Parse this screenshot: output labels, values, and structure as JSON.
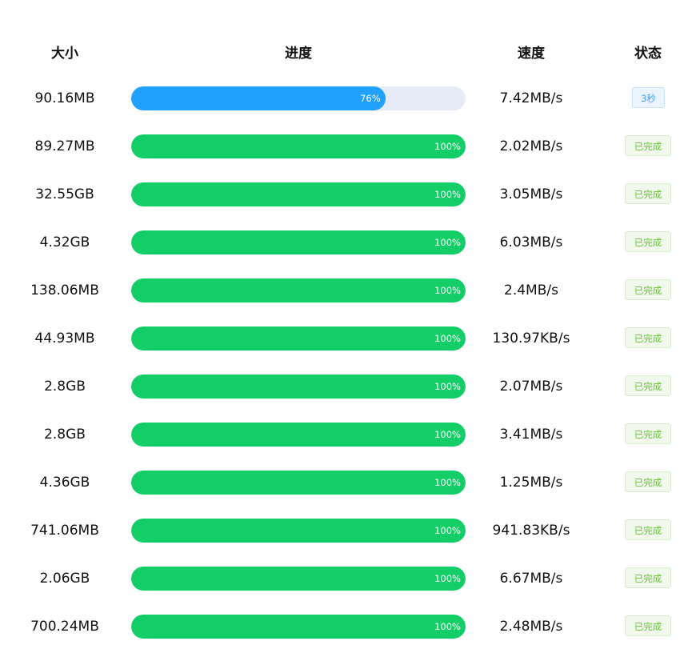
{
  "header": {
    "size": "大小",
    "progress": "进度",
    "speed": "速度",
    "status": "状态"
  },
  "colors": {
    "active": "#20a0ff",
    "done": "#13ce66",
    "track": "#e6ebf5"
  },
  "rows": [
    {
      "size": "90.16MB",
      "progress_pct": 76,
      "progress_label": "76%",
      "speed": "7.42MB/s",
      "status": "3秒",
      "state": "active"
    },
    {
      "size": "89.27MB",
      "progress_pct": 100,
      "progress_label": "100%",
      "speed": "2.02MB/s",
      "status": "已完成",
      "state": "done"
    },
    {
      "size": "32.55GB",
      "progress_pct": 100,
      "progress_label": "100%",
      "speed": "3.05MB/s",
      "status": "已完成",
      "state": "done"
    },
    {
      "size": "4.32GB",
      "progress_pct": 100,
      "progress_label": "100%",
      "speed": "6.03MB/s",
      "status": "已完成",
      "state": "done"
    },
    {
      "size": "138.06MB",
      "progress_pct": 100,
      "progress_label": "100%",
      "speed": "2.4MB/s",
      "status": "已完成",
      "state": "done"
    },
    {
      "size": "44.93MB",
      "progress_pct": 100,
      "progress_label": "100%",
      "speed": "130.97KB/s",
      "status": "已完成",
      "state": "done"
    },
    {
      "size": "2.8GB",
      "progress_pct": 100,
      "progress_label": "100%",
      "speed": "2.07MB/s",
      "status": "已完成",
      "state": "done"
    },
    {
      "size": "2.8GB",
      "progress_pct": 100,
      "progress_label": "100%",
      "speed": "3.41MB/s",
      "status": "已完成",
      "state": "done"
    },
    {
      "size": "4.36GB",
      "progress_pct": 100,
      "progress_label": "100%",
      "speed": "1.25MB/s",
      "status": "已完成",
      "state": "done"
    },
    {
      "size": "741.06MB",
      "progress_pct": 100,
      "progress_label": "100%",
      "speed": "941.83KB/s",
      "status": "已完成",
      "state": "done"
    },
    {
      "size": "2.06GB",
      "progress_pct": 100,
      "progress_label": "100%",
      "speed": "6.67MB/s",
      "status": "已完成",
      "state": "done"
    },
    {
      "size": "700.24MB",
      "progress_pct": 100,
      "progress_label": "100%",
      "speed": "2.48MB/s",
      "status": "已完成",
      "state": "done"
    }
  ]
}
